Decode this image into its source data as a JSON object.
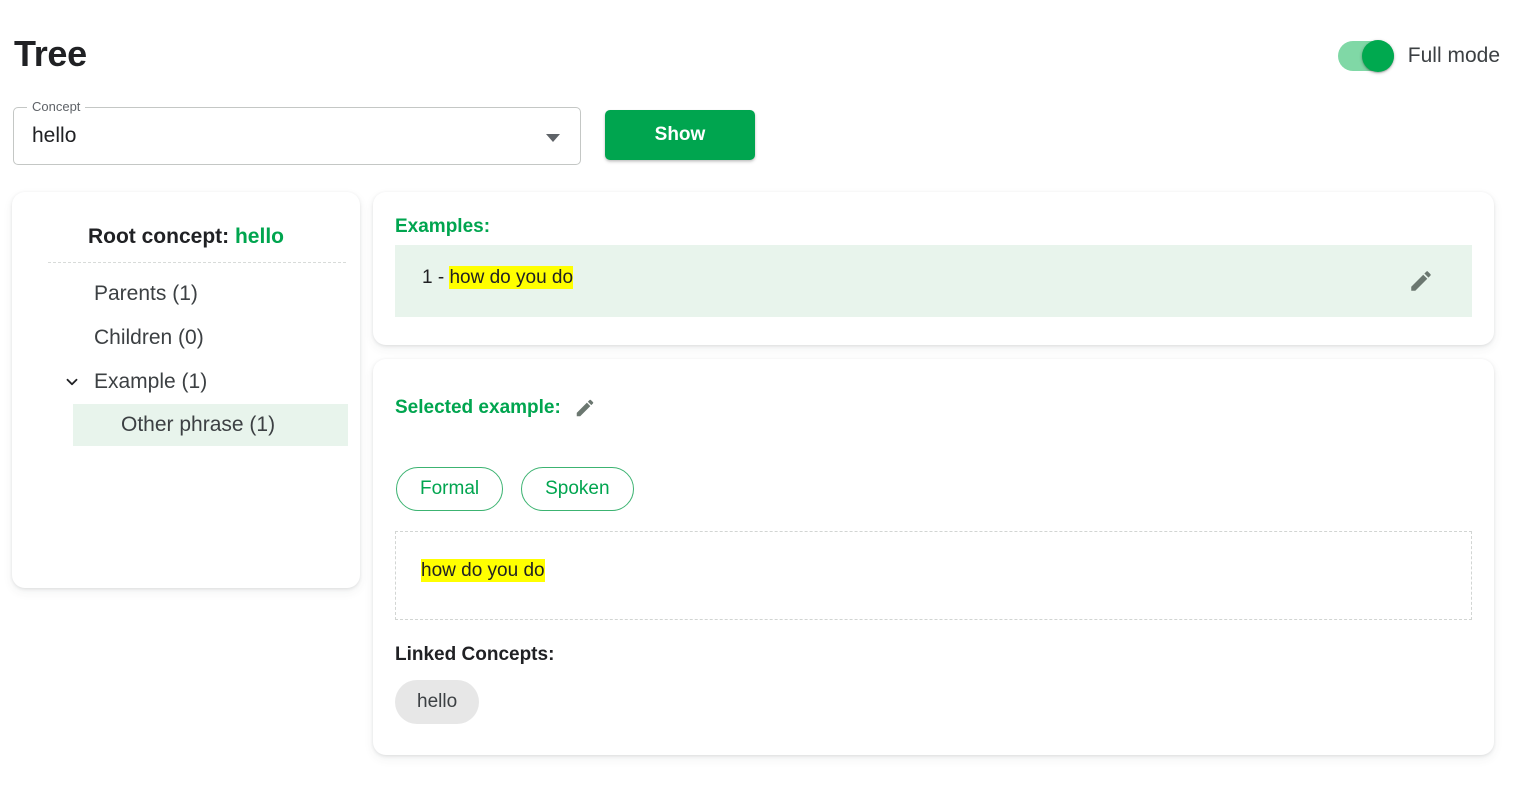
{
  "header": {
    "title": "Tree",
    "mode_toggle_label": "Full mode",
    "mode_toggle_state": "on"
  },
  "concept_field": {
    "legend": "Concept",
    "value": "hello",
    "dropdown_icon": "chevron-down-icon"
  },
  "show_button": {
    "label": "Show"
  },
  "tree_panel": {
    "root_prefix": "Root concept:",
    "root_value": "hello",
    "nodes": [
      {
        "label": "Parents (1)",
        "level": 1,
        "expandable": false
      },
      {
        "label": "Children (0)",
        "level": 1,
        "expandable": false
      },
      {
        "label": "Example (1)",
        "level": 1,
        "expandable": true,
        "expanded": true
      },
      {
        "label": "Other phrase (1)",
        "level": 2,
        "selected": true
      }
    ]
  },
  "examples_panel": {
    "heading": "Examples:",
    "rows": [
      {
        "index": "1 - ",
        "text": "how do you do",
        "highlighted": true,
        "edit_icon": "pencil-icon"
      }
    ]
  },
  "selected_example_panel": {
    "heading": "Selected example:",
    "edit_icon": "pencil-icon",
    "chips": [
      {
        "label": "Formal"
      },
      {
        "label": "Spoken"
      }
    ],
    "phrase": "how do you do",
    "linked_heading": "Linked Concepts:",
    "linked_concepts": [
      {
        "label": "hello"
      }
    ]
  },
  "colors": {
    "accent_green": "#00a54f",
    "toggle_track": "#80d8a6",
    "highlight_yellow": "#ffff00",
    "row_selected_bg": "#e8f4ec",
    "chip_gray": "#e7e7e7",
    "page_bg": "#ffffff"
  }
}
